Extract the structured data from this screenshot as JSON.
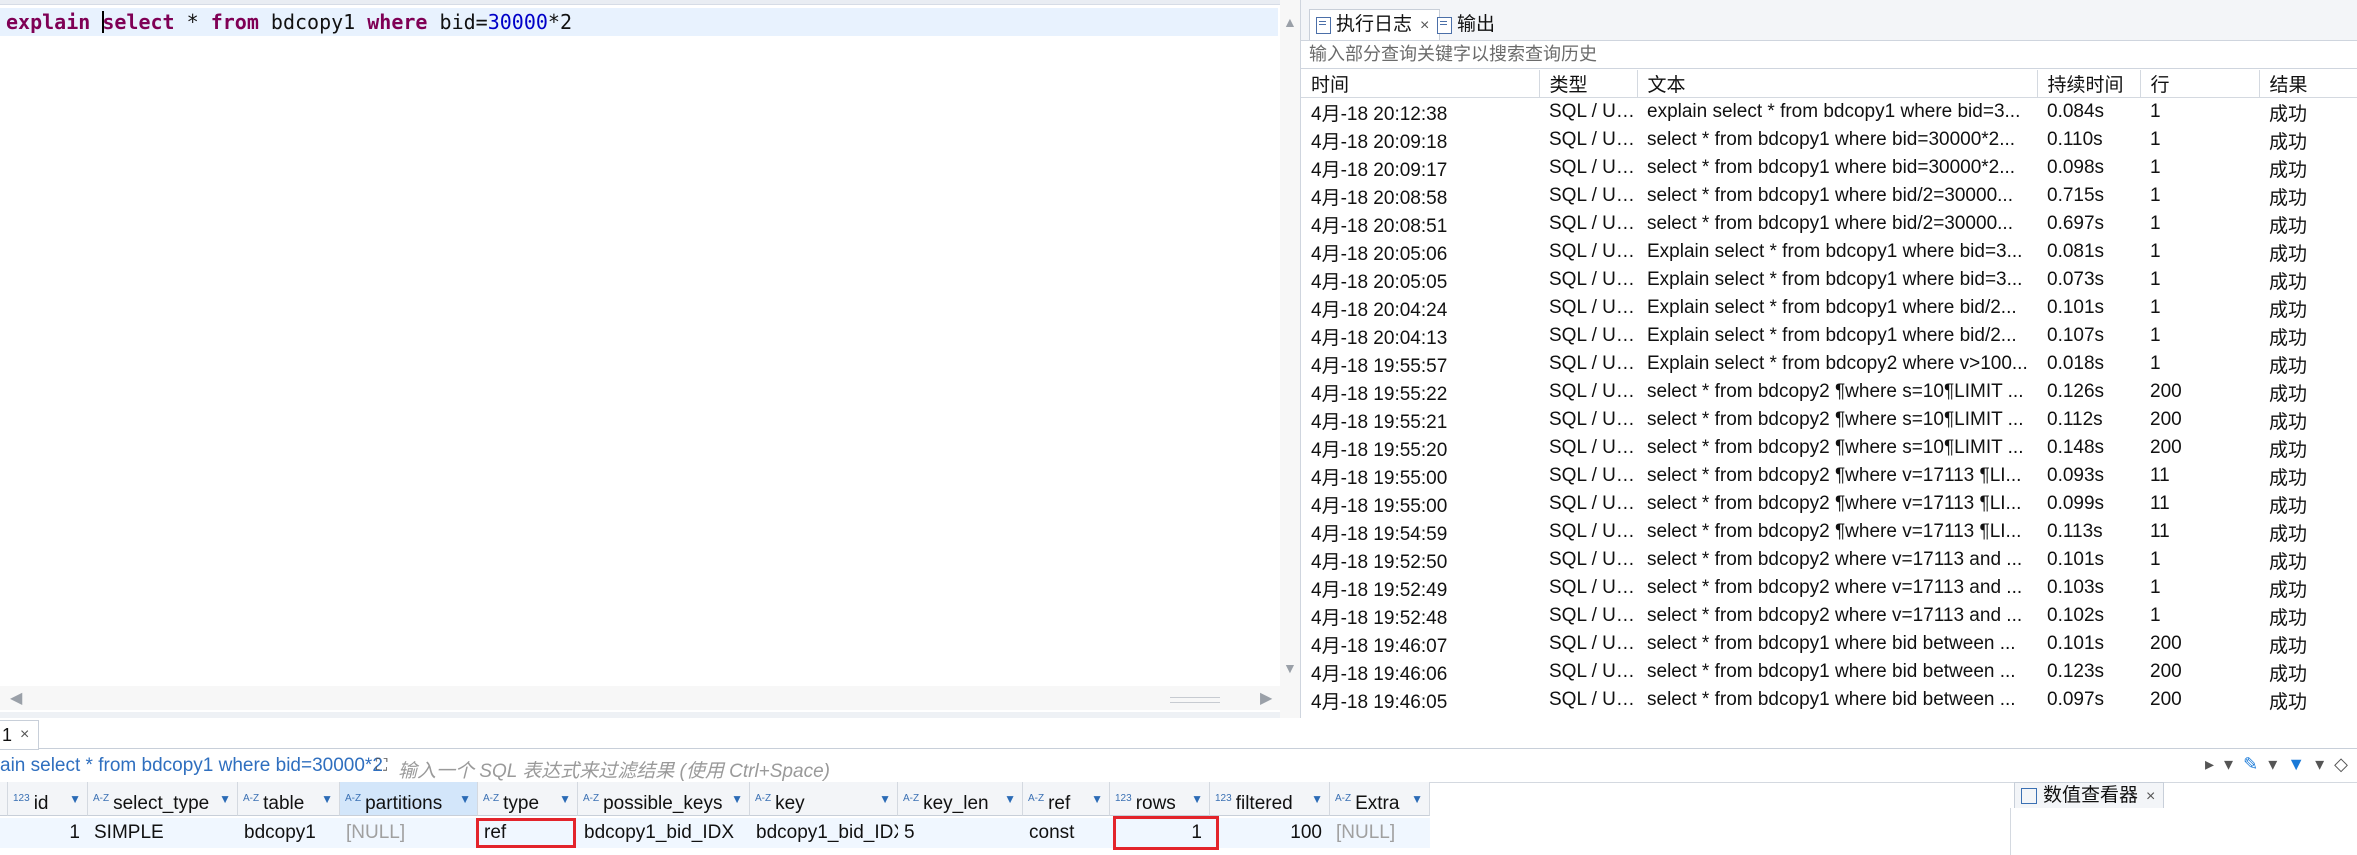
{
  "editor": {
    "sql": {
      "t1": "explain",
      "t2": " ",
      "t3": "select",
      "t4": " * ",
      "t5": "from",
      "t6": " bdcopy1 ",
      "t7": "where",
      "t8": " bid=",
      "t9": "30000",
      "t10": "*2"
    }
  },
  "right_panel": {
    "tabs": [
      {
        "label": "执行日志",
        "close": "×"
      },
      {
        "label": "输出"
      }
    ],
    "search_placeholder": "输入部分查询关键字以搜索查询历史",
    "columns": [
      "时间",
      "类型",
      "文本",
      "持续时间",
      "行",
      "结果"
    ],
    "rows": [
      {
        "time": "4月-18 20:12:38",
        "type": "SQL / Us...",
        "text": "explain select * from bdcopy1 where bid=3...",
        "dur": "0.084s",
        "rows": "1",
        "result": "成功"
      },
      {
        "time": "4月-18 20:09:18",
        "type": "SQL / Us...",
        "text": "select * from bdcopy1 where bid=30000*2...",
        "dur": "0.110s",
        "rows": "1",
        "result": "成功"
      },
      {
        "time": "4月-18 20:09:17",
        "type": "SQL / Us...",
        "text": "select * from bdcopy1 where bid=30000*2...",
        "dur": "0.098s",
        "rows": "1",
        "result": "成功"
      },
      {
        "time": "4月-18 20:08:58",
        "type": "SQL / Us...",
        "text": "select * from bdcopy1 where bid/2=30000...",
        "dur": "0.715s",
        "rows": "1",
        "result": "成功"
      },
      {
        "time": "4月-18 20:08:51",
        "type": "SQL / Us...",
        "text": "select * from bdcopy1 where bid/2=30000...",
        "dur": "0.697s",
        "rows": "1",
        "result": "成功"
      },
      {
        "time": "4月-18 20:05:06",
        "type": "SQL / Us...",
        "text": "Explain select * from bdcopy1 where bid=3...",
        "dur": "0.081s",
        "rows": "1",
        "result": "成功"
      },
      {
        "time": "4月-18 20:05:05",
        "type": "SQL / Us...",
        "text": "Explain select * from bdcopy1 where bid=3...",
        "dur": "0.073s",
        "rows": "1",
        "result": "成功"
      },
      {
        "time": "4月-18 20:04:24",
        "type": "SQL / Us...",
        "text": "Explain select * from bdcopy1 where bid/2...",
        "dur": "0.101s",
        "rows": "1",
        "result": "成功"
      },
      {
        "time": "4月-18 20:04:13",
        "type": "SQL / Us...",
        "text": "Explain select * from bdcopy1 where bid/2...",
        "dur": "0.107s",
        "rows": "1",
        "result": "成功"
      },
      {
        "time": "4月-18 19:55:57",
        "type": "SQL / Us...",
        "text": "Explain select * from bdcopy2 where v>100...",
        "dur": "0.018s",
        "rows": "1",
        "result": "成功"
      },
      {
        "time": "4月-18 19:55:22",
        "type": "SQL / Us...",
        "text": "select * from bdcopy2 ¶where s=10¶LIMIT ...",
        "dur": "0.126s",
        "rows": "200",
        "result": "成功"
      },
      {
        "time": "4月-18 19:55:21",
        "type": "SQL / Us...",
        "text": "select * from bdcopy2 ¶where s=10¶LIMIT ...",
        "dur": "0.112s",
        "rows": "200",
        "result": "成功"
      },
      {
        "time": "4月-18 19:55:20",
        "type": "SQL / Us...",
        "text": "select * from bdcopy2 ¶where s=10¶LIMIT ...",
        "dur": "0.148s",
        "rows": "200",
        "result": "成功"
      },
      {
        "time": "4月-18 19:55:00",
        "type": "SQL / Us...",
        "text": "select * from bdcopy2 ¶where v=17113 ¶LI...",
        "dur": "0.093s",
        "rows": "11",
        "result": "成功"
      },
      {
        "time": "4月-18 19:55:00",
        "type": "SQL / Us...",
        "text": "select * from bdcopy2 ¶where v=17113 ¶LI...",
        "dur": "0.099s",
        "rows": "11",
        "result": "成功"
      },
      {
        "time": "4月-18 19:54:59",
        "type": "SQL / Us...",
        "text": "select * from bdcopy2 ¶where v=17113 ¶LI...",
        "dur": "0.113s",
        "rows": "11",
        "result": "成功"
      },
      {
        "time": "4月-18 19:52:50",
        "type": "SQL / Us...",
        "text": "select * from bdcopy2 where v=17113 and ...",
        "dur": "0.101s",
        "rows": "1",
        "result": "成功"
      },
      {
        "time": "4月-18 19:52:49",
        "type": "SQL / Us...",
        "text": "select * from bdcopy2 where v=17113 and ...",
        "dur": "0.103s",
        "rows": "1",
        "result": "成功"
      },
      {
        "time": "4月-18 19:52:48",
        "type": "SQL / Us...",
        "text": "select * from bdcopy2 where v=17113 and ...",
        "dur": "0.102s",
        "rows": "1",
        "result": "成功"
      },
      {
        "time": "4月-18 19:46:07",
        "type": "SQL / Us...",
        "text": "select * from bdcopy1 where bid between ...",
        "dur": "0.101s",
        "rows": "200",
        "result": "成功"
      },
      {
        "time": "4月-18 19:46:06",
        "type": "SQL / Us...",
        "text": "select * from bdcopy1 where bid between ...",
        "dur": "0.123s",
        "rows": "200",
        "result": "成功"
      },
      {
        "time": "4月-18 19:46:05",
        "type": "SQL / Us...",
        "text": "select * from bdcopy1 where bid between ...",
        "dur": "0.097s",
        "rows": "200",
        "result": "成功"
      }
    ]
  },
  "results": {
    "tab_label": "1",
    "tab_close": "×",
    "query_text": "ain select * from bdcopy1 where bid=30000*2",
    "filter_placeholder": "输入一个 SQL 表达式来过滤结果 (使用 Ctrl+Space)",
    "columns": [
      {
        "type": "123",
        "name": "id"
      },
      {
        "type": "A-Z",
        "name": "select_type"
      },
      {
        "type": "A-Z",
        "name": "table"
      },
      {
        "type": "A-Z",
        "name": "partitions"
      },
      {
        "type": "A-Z",
        "name": "type"
      },
      {
        "type": "A-Z",
        "name": "possible_keys"
      },
      {
        "type": "A-Z",
        "name": "key"
      },
      {
        "type": "A-Z",
        "name": "key_len"
      },
      {
        "type": "A-Z",
        "name": "ref"
      },
      {
        "type": "123",
        "name": "rows"
      },
      {
        "type": "123",
        "name": "filtered"
      },
      {
        "type": "A-Z",
        "name": "Extra"
      }
    ],
    "row": {
      "id": "1",
      "select_type": "SIMPLE",
      "table": "bdcopy1",
      "partitions": "[NULL]",
      "type": "ref",
      "possible_keys": "bdcopy1_bid_IDX",
      "key": "bdcopy1_bid_IDX",
      "key_len": "5",
      "ref": "const",
      "rows": "1",
      "filtered": "100",
      "extra": "[NULL]"
    },
    "value_viewer": {
      "label": "数值查看器",
      "close": "×"
    }
  },
  "colors": {
    "keyword": "#7f0055",
    "number": "#0000c8",
    "highlight_box": "#e3242b",
    "selected_header": "#d3e6fa"
  }
}
